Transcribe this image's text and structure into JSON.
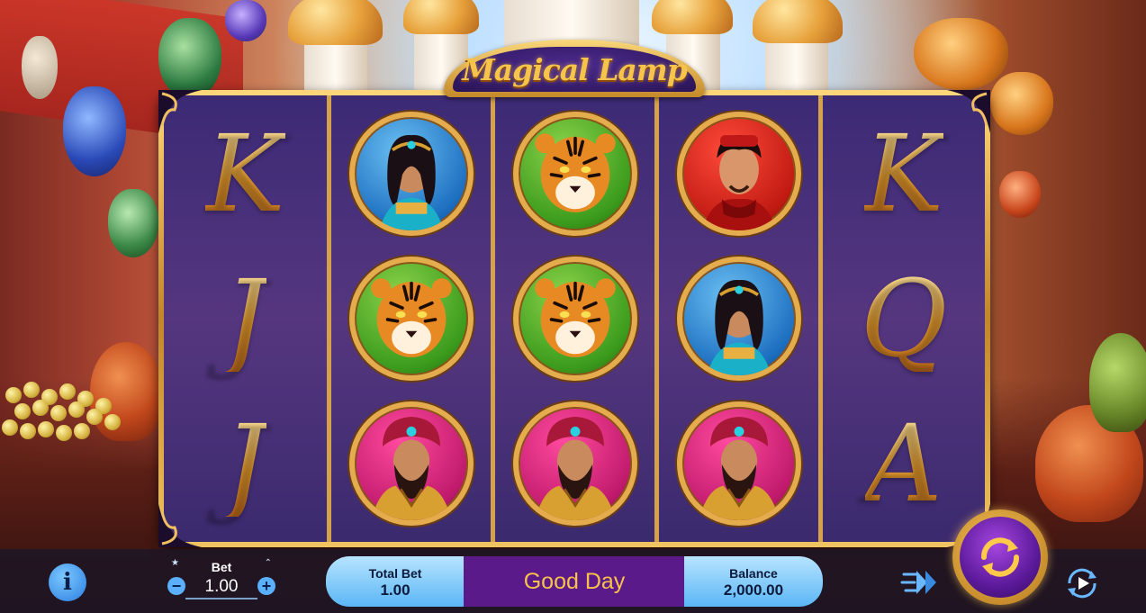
{
  "game": {
    "title": "Magical Lamp"
  },
  "reels": [
    [
      "K",
      "J",
      "J"
    ],
    [
      "princess",
      "tiger",
      "sultan"
    ],
    [
      "tiger",
      "tiger",
      "sultan"
    ],
    [
      "hero",
      "princess",
      "sultan"
    ],
    [
      "K",
      "Q",
      "A"
    ]
  ],
  "controls": {
    "info_icon": "info-icon",
    "bet_label": "Bet",
    "bet_value": "1.00",
    "bet_minus": "−",
    "bet_plus": "+",
    "total_bet_label": "Total Bet",
    "total_bet_value": "1.00",
    "message": "Good Day",
    "balance_label": "Balance",
    "balance_value": "2,000.00",
    "turbo_icon": "fast-forward-icon",
    "spin_icon": "spin-arrows-icon",
    "autoplay_icon": "autoplay-icon"
  },
  "colors": {
    "gold": "#e4ac4c",
    "reel_bg": "#3c2a75",
    "message_bg": "#5b1a8a",
    "message_text": "#f8c24a",
    "panel_blue": "#5ab6f6"
  }
}
